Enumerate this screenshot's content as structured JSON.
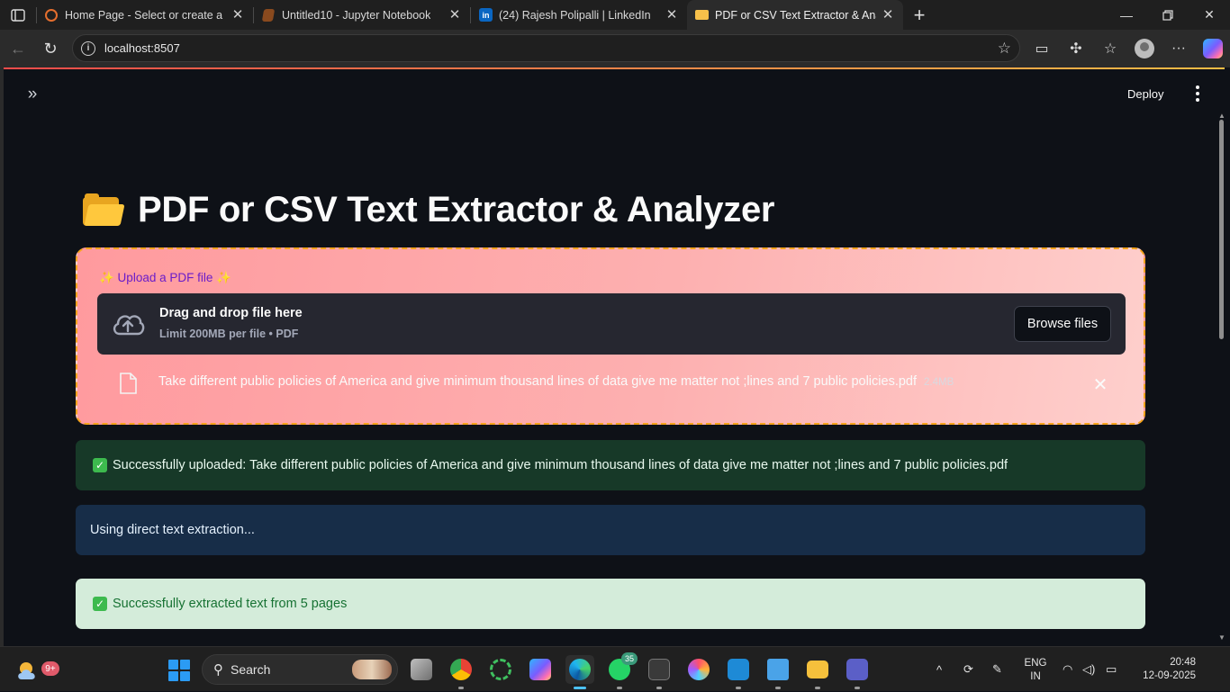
{
  "browser": {
    "tabs": [
      {
        "title": "Home Page - Select or create a no",
        "icon": "jupyter-home-icon",
        "active": false
      },
      {
        "title": "Untitled10 - Jupyter Notebook",
        "icon": "jupyter-notebook-icon",
        "active": false
      },
      {
        "title": "(24) Rajesh Polipalli | LinkedIn",
        "icon": "linkedin-icon",
        "active": false
      },
      {
        "title": "PDF or CSV Text Extractor & Analy",
        "icon": "folder-icon",
        "active": true
      }
    ],
    "url": "localhost:8507"
  },
  "app": {
    "deploy_label": "Deploy",
    "title": "PDF or CSV Text Extractor & Analyzer",
    "uploader": {
      "label": "✨ Upload a PDF file ✨",
      "drop_title": "Drag and drop file here",
      "drop_subtitle": "Limit 200MB per file • PDF",
      "browse_label": "Browse files",
      "file_name": "Take different public policies of America and give minimum thousand lines of data give me matter not ;lines and 7 public policies.pdf",
      "file_size": "2.4MB"
    },
    "alerts": {
      "uploaded": "Successfully uploaded: Take different public policies of America and give minimum thousand lines of data give me matter not ;lines and 7 public policies.pdf",
      "info": "Using direct text extraction...",
      "extracted": "Successfully extracted text from 5 pages"
    }
  },
  "taskbar": {
    "weather_badge": "9+",
    "search_label": "Search",
    "whatsapp_badge": "35",
    "language_line1": "ENG",
    "language_line2": "IN",
    "time": "20:48",
    "date": "12-09-2025"
  },
  "colors": {
    "accent_orange": "#f5a31a",
    "success_dark": "#173928",
    "info_dark": "#172d48",
    "success_light": "#d4ecda",
    "upload_label_purple": "#6a1cc9"
  }
}
